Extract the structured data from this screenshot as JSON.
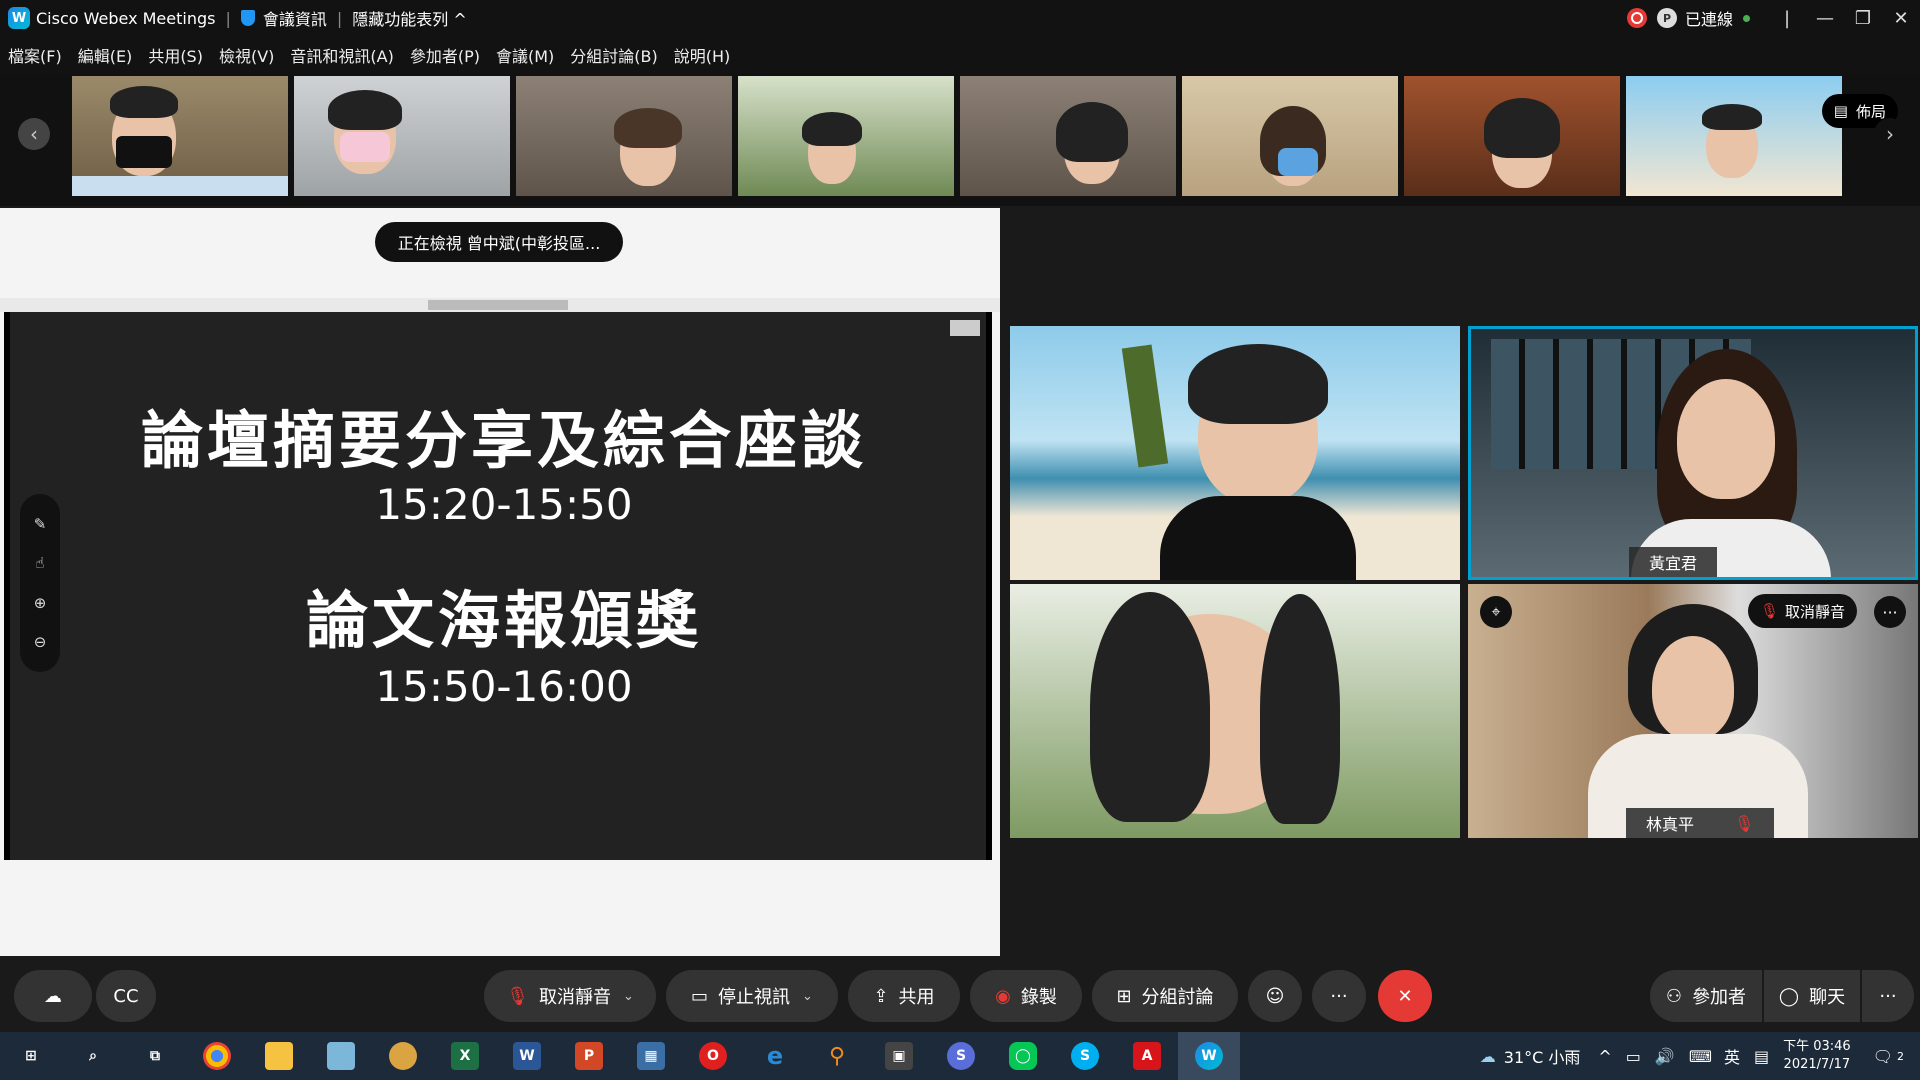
{
  "titlebar": {
    "app_name": "Cisco Webex Meetings",
    "meeting_info": "會議資訊",
    "hide_menu": "隱藏功能表列 ^",
    "status": "已連線"
  },
  "menu": [
    "檔案(F)",
    "編輯(E)",
    "共用(S)",
    "檢視(V)",
    "音訊和視訊(A)",
    "參加者(P)",
    "會議(M)",
    "分組討論(B)",
    "說明(H)"
  ],
  "strip": {
    "layout_label": "佈局"
  },
  "share": {
    "viewing_label": "正在檢視 曾中斌(中彰投區...",
    "mini_bar_text": "...",
    "slide_title_1": "論壇摘要分享及綜合座談",
    "slide_time_1": "15:20-15:50",
    "slide_title_2": "論文海報頒獎",
    "slide_time_2": "15:50-16:00"
  },
  "videos": {
    "tile2_name": "黃宜君",
    "tile4_name": "林真平",
    "tile4_unmute": "取消靜音"
  },
  "controls": {
    "unmute": "取消靜音",
    "stop_video": "停止視訊",
    "share": "共用",
    "record": "錄製",
    "breakout": "分組討論",
    "participants": "參加者",
    "chat": "聊天"
  },
  "taskbar": {
    "weather": "31°C 小雨",
    "ime": "英",
    "time": "下午 03:46",
    "date": "2021/7/17",
    "notifications": "2"
  },
  "colors": {
    "accent": "#00a0d1",
    "end_red": "#e53935",
    "mute_red": "#e53935"
  }
}
